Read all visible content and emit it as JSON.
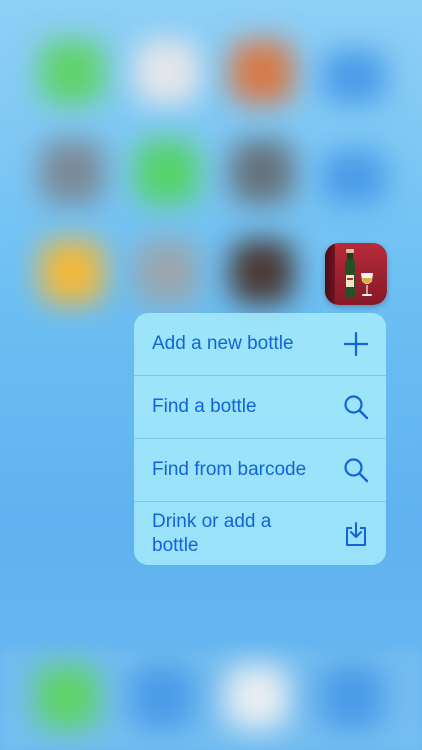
{
  "app": {
    "icon_name": "wine-bottle-book-icon",
    "accent": "#1463d9"
  },
  "quick_actions": [
    {
      "label": "Add a new bottle",
      "icon": "plus-icon"
    },
    {
      "label": "Find a bottle",
      "icon": "search-icon"
    },
    {
      "label": "Find from barcode",
      "icon": "search-icon"
    },
    {
      "label": "Drink or add a bottle",
      "icon": "tray-download-icon"
    }
  ]
}
